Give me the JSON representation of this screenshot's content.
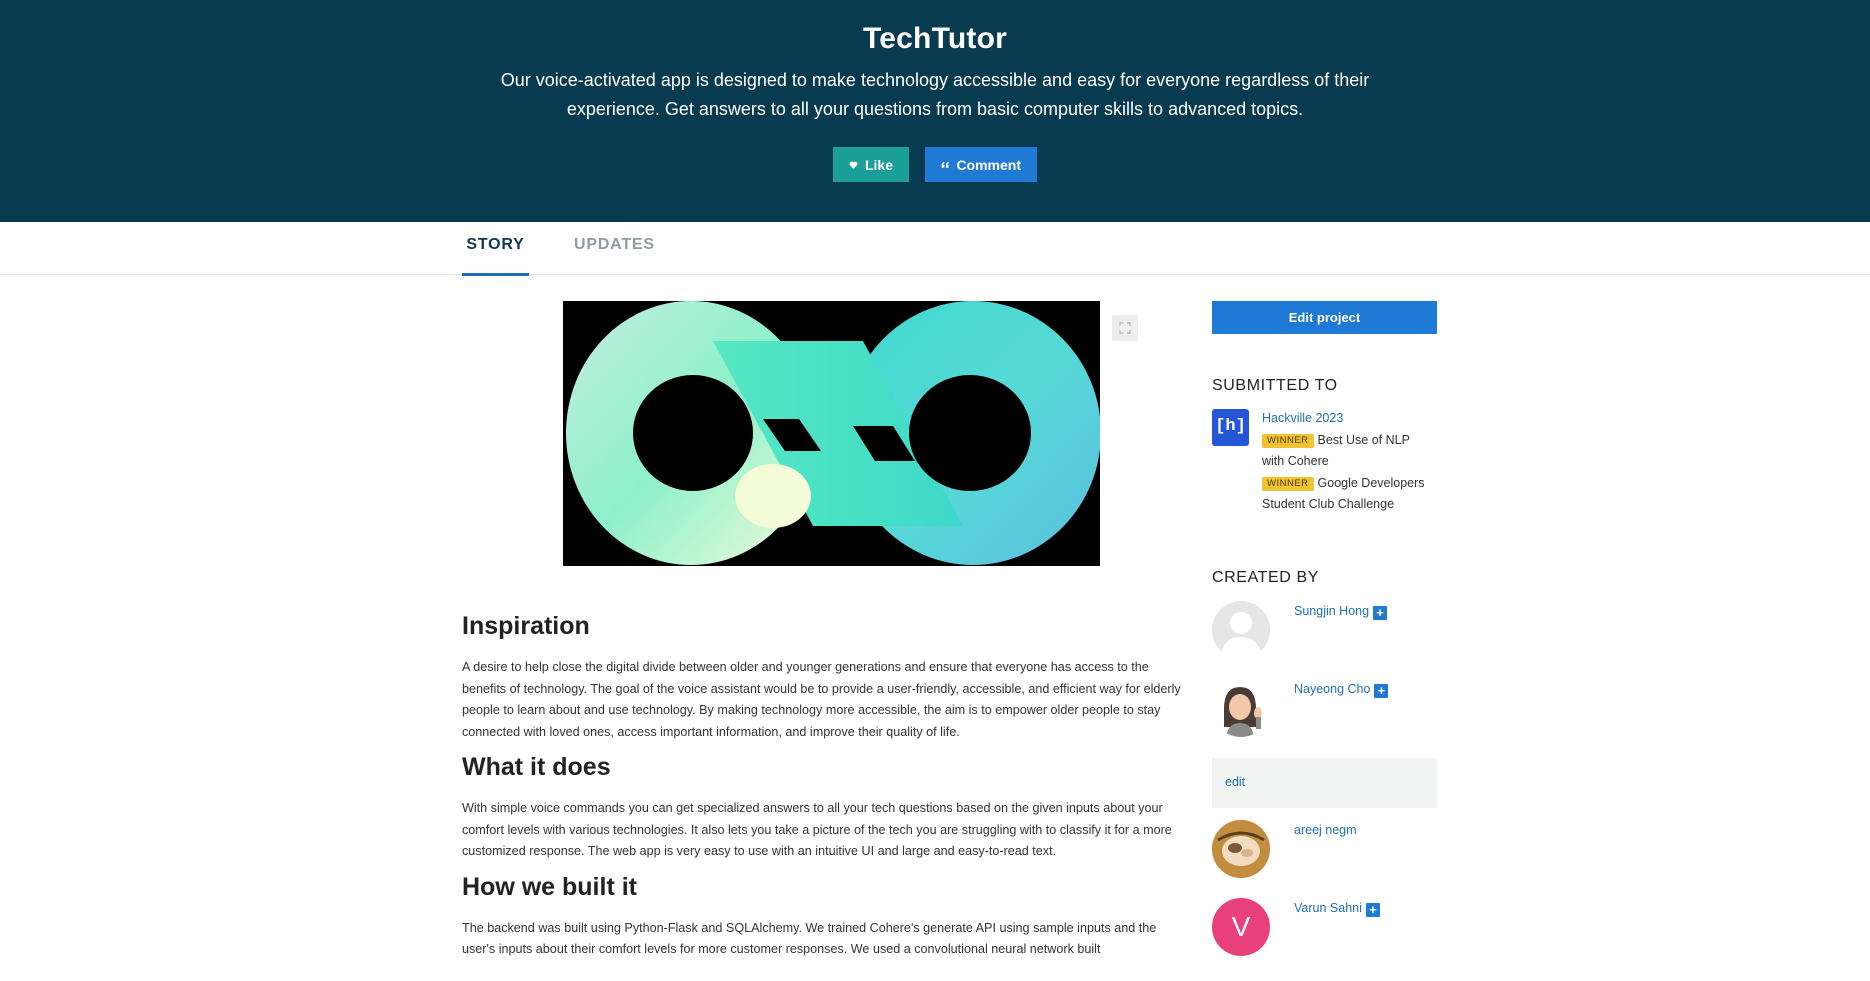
{
  "hero": {
    "title": "TechTutor",
    "tagline": "Our voice-activated app is designed to make technology accessible and easy for everyone regardless of their experience. Get answers to all your questions from basic computer skills to advanced topics.",
    "like_label": "Like",
    "comment_label": "Comment",
    "background_color": "#083b4f",
    "like_color": "#1a9f9a",
    "comment_color": "#1f7ad6"
  },
  "tabs": [
    {
      "label": "STORY",
      "active": true
    },
    {
      "label": "UPDATES",
      "active": false
    }
  ],
  "content": {
    "sections": [
      {
        "heading": "Inspiration",
        "text": "A desire to help close the digital divide between older and younger generations and ensure that everyone has access to the benefits of technology. The goal of the voice assistant would be to provide a user-friendly, accessible, and efficient way for elderly people to learn about and use technology. By making technology more accessible, the aim is to empower older people to stay connected with loved ones, access important information, and improve their quality of life."
      },
      {
        "heading": "What it does",
        "text": "With simple voice commands you can get specialized answers to all your tech questions based on the given inputs about your comfort levels with various technologies. It also lets you take a picture of the tech you are struggling with to classify it for a more customized response. The web app is very easy to use with an intuitive UI and large and easy-to-read text."
      },
      {
        "heading": "How we built it",
        "text": "The backend was built using Python-Flask and SQLAlchemy. We trained Cohere's generate API using sample inputs and the user's inputs about their comfort levels for more customer responses. We used a convolutional neural network built"
      }
    ]
  },
  "sidebar": {
    "edit_project_label": "Edit project",
    "submitted_to_heading": "SUBMITTED TO",
    "hackathon_name": "Hackville 2023",
    "logo_text": "[h]",
    "awards": [
      {
        "badge": "WINNER",
        "prize": "Best Use of NLP with Cohere"
      },
      {
        "badge": "WINNER",
        "prize": "Google Developers Student Club Challenge"
      }
    ],
    "created_by_heading": "CREATED BY",
    "members": [
      {
        "name": "Sungjin Hong",
        "plus": "+"
      },
      {
        "name": "Nayeong Cho",
        "plus": "+"
      },
      {
        "name": "areej negm",
        "plus": ""
      },
      {
        "name": "Varun Sahni",
        "plus": "+",
        "initial": "V"
      }
    ],
    "edit_link_label": "edit"
  }
}
